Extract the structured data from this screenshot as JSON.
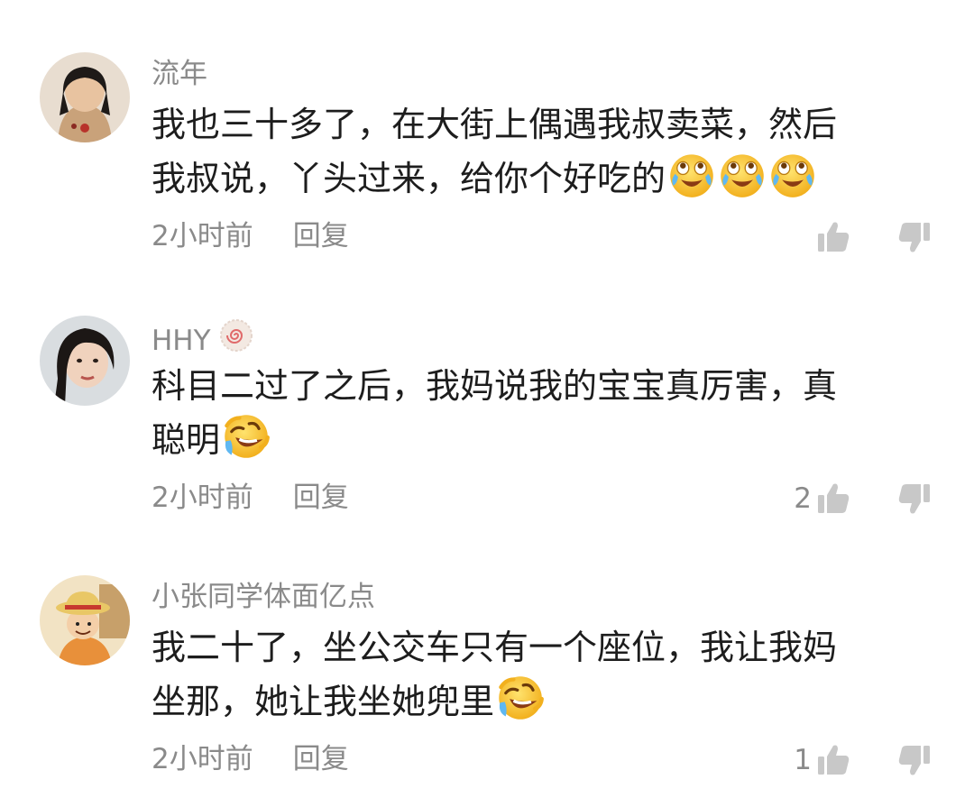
{
  "comments": [
    {
      "username": "流年",
      "lines": [
        "我也三十多了，在大街上偶遇我叔卖菜，然后",
        "我叔说，丫头过来，给你个好吃的"
      ],
      "time": "2小时前",
      "reply_label": "回复",
      "likes": "",
      "emojis": [
        "laugh-cry-emoji",
        "laugh-cry-emoji",
        "laugh-cry-emoji"
      ]
    },
    {
      "username": "HHY",
      "lines": [
        "科目二过了之后，我妈说我的宝宝真厉害，真",
        "聪明"
      ],
      "time": "2小时前",
      "reply_label": "回复",
      "likes": "2",
      "emojis": [
        "rofl-emoji"
      ]
    },
    {
      "username": "小张同学体面亿点",
      "lines": [
        "我二十了，坐公交车只有一个座位，我让我妈",
        "坐那，她让我坐她兜里"
      ],
      "time": "2小时前",
      "reply_label": "回复",
      "likes": "1",
      "emojis": [
        "rofl-emoji"
      ]
    }
  ],
  "colors": {
    "meta_text": "#8a8a8a",
    "body_text": "#1d1d1d",
    "icon": "#c8c8c8",
    "emoji_face": "#f7c531"
  }
}
